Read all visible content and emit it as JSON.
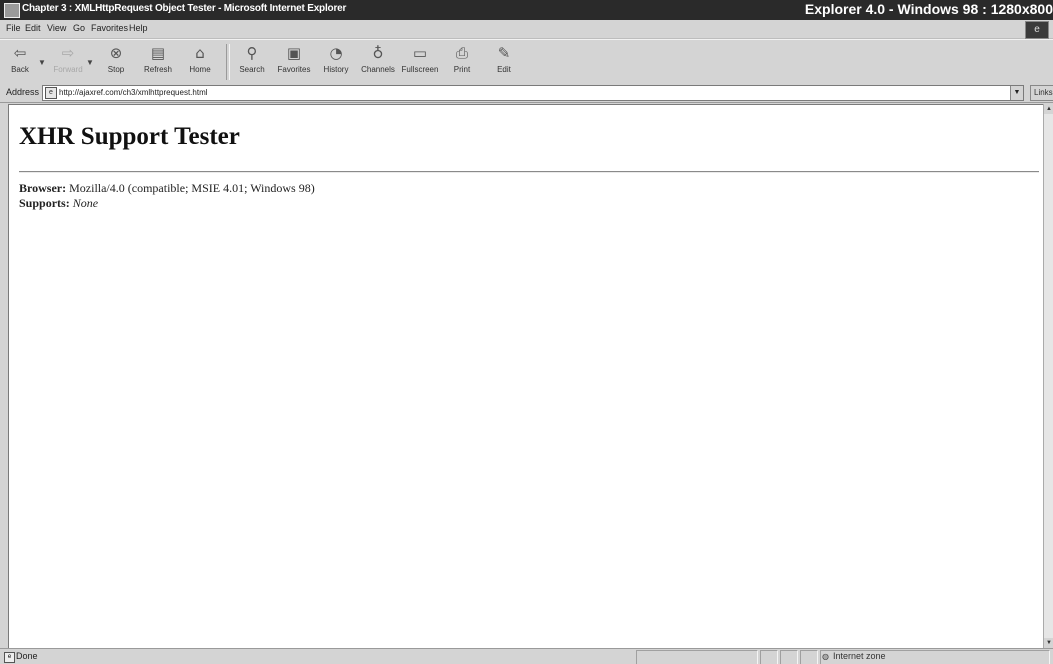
{
  "window": {
    "title": "Chapter 3 : XMLHttpRequest Object Tester - Microsoft Internet Explorer",
    "overlay_caption": "Explorer 4.0 - Windows 98 : 1280x800"
  },
  "menu": [
    "File",
    "Edit",
    "View",
    "Go",
    "Favorites",
    "Help"
  ],
  "toolbar": {
    "back": "Back",
    "forward": "Forward",
    "stop": "Stop",
    "refresh": "Refresh",
    "home": "Home",
    "search": "Search",
    "favorites": "Favorites",
    "history": "History",
    "channels": "Channels",
    "fullscreen": "Fullscreen",
    "print": "Print",
    "edit": "Edit"
  },
  "address": {
    "label": "Address",
    "url": "http://ajaxref.com/ch3/xmlhttprequest.html",
    "links": "Links"
  },
  "page": {
    "heading": "XHR Support Tester",
    "browser_label": "Browser:",
    "browser_value": "Mozilla/4.0 (compatible; MSIE 4.01; Windows 98)",
    "supports_label": "Supports:",
    "supports_value": "None"
  },
  "status": {
    "text": "Done",
    "zone": "Internet zone"
  }
}
